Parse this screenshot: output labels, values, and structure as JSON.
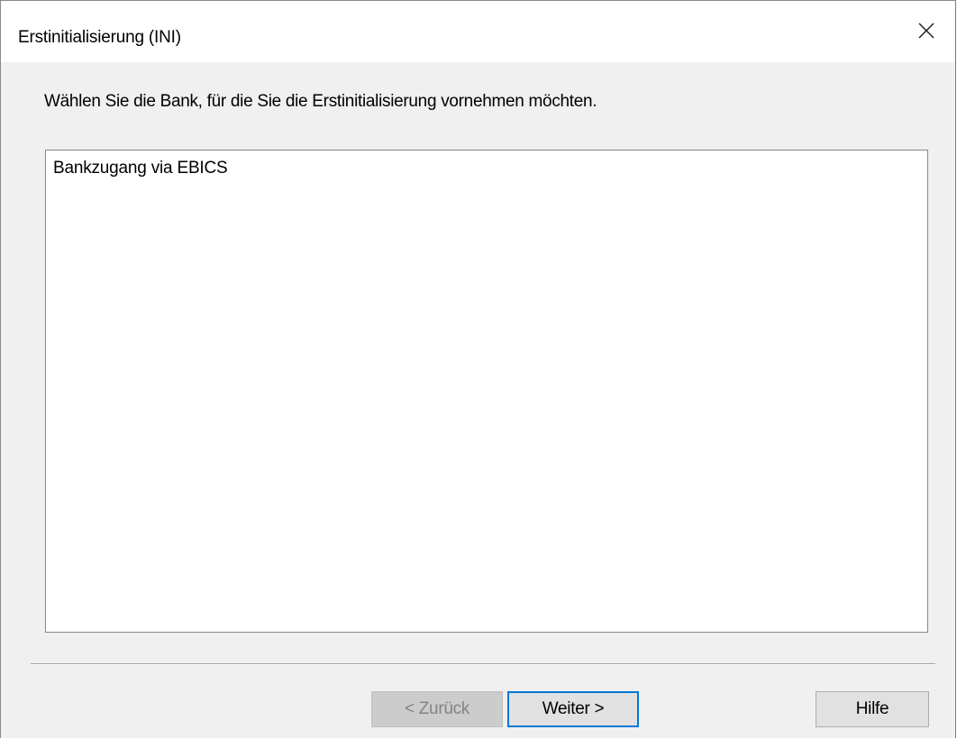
{
  "window": {
    "title": "Erstinitialisierung (INI)",
    "close_icon": "close-icon"
  },
  "content": {
    "instruction": "Wählen Sie die Bank, für die Sie die Erstinitialisierung vornehmen möchten.",
    "bank_list": {
      "items": [
        {
          "label": "Bankzugang via EBICS"
        }
      ]
    }
  },
  "buttons": {
    "back_label": "< Zurück",
    "next_label": "Weiter >",
    "help_label": "Hilfe"
  },
  "colors": {
    "dialog_background": "#f0f0f0",
    "focus_border": "#0078d7",
    "disabled_text": "#838383"
  }
}
